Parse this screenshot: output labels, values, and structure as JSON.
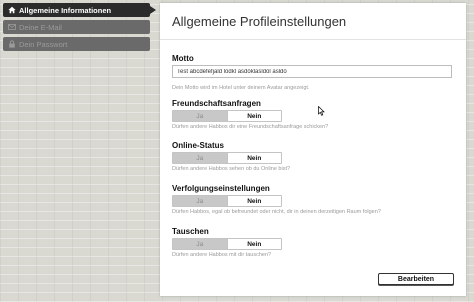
{
  "sidebar": {
    "items": [
      {
        "label": "Allgemeine Informationen",
        "icon": "home-icon",
        "state": "active"
      },
      {
        "label": "Deine E-Mail",
        "icon": "envelope-icon",
        "state": "disabled"
      },
      {
        "label": "Dein Passwort",
        "icon": "lock-icon",
        "state": "disabled"
      }
    ]
  },
  "main": {
    "title": "Allgemeine Profileinstellungen",
    "motto": {
      "label": "Motto",
      "value": "Test abcdefefjald lödkl asdöklasldöl asldö",
      "hint": "Dein Motto wird im Hotel unter deinem Avatar angezeigt."
    },
    "settings": [
      {
        "label": "Freundschaftsanfragen",
        "yes": "Ja",
        "no": "Nein",
        "selected": "Nein",
        "hint": "Dürfen andere Habbos dir eine Freundschaftsanfrage schicken?"
      },
      {
        "label": "Online-Status",
        "yes": "Ja",
        "no": "Nein",
        "selected": "Nein",
        "hint": "Dürfen andere Habbos sehen ob du Online bist?"
      },
      {
        "label": "Verfolgungseinstellungen",
        "yes": "Ja",
        "no": "Nein",
        "selected": "Nein",
        "hint": "Dürfen Habbos, egal ob befreundet oder nicht, dir in deinen derzeitigen Raum folgen?"
      },
      {
        "label": "Tauschen",
        "yes": "Ja",
        "no": "Nein",
        "selected": "Nein",
        "hint": "Dürfen andere Habbos mit dir tauschen?"
      }
    ],
    "save_label": "Bearbeiten"
  }
}
